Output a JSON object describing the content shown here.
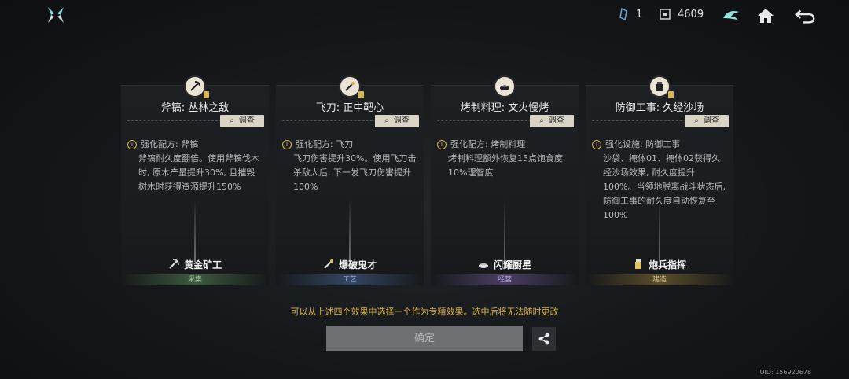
{
  "topbar": {
    "resources": [
      {
        "icon": "crystal-icon",
        "value": "1"
      },
      {
        "icon": "token-icon",
        "value": "4609"
      }
    ]
  },
  "cards": [
    {
      "title": "斧镐: 丛林之敌",
      "investigate": "调查",
      "desc_head": "强化配方: 斧镐",
      "desc_body": "斧镐耐久度翻倍。使用斧镐伐木时, 原木产量提升30%, 且摧毁树木时获得资源提升150%",
      "badge": "黄金矿工",
      "category": "采集",
      "category_color": "#3d5a3f"
    },
    {
      "title": "飞刀: 正中靶心",
      "investigate": "调查",
      "desc_head": "强化配方: 飞刀",
      "desc_body": "飞刀伤害提升30%。使用飞刀击杀敌人后, 下一发飞刀伤害提升100%",
      "badge": "爆破鬼才",
      "category": "工艺",
      "category_color": "#344663"
    },
    {
      "title": "烤制料理: 文火慢烤",
      "investigate": "调查",
      "desc_head": "强化配方: 烤制料理",
      "desc_body": "烤制料理额外恢复15点饱食度, 10%理智度",
      "badge": "闪耀厨星",
      "category": "经营",
      "category_color": "#4a3f63"
    },
    {
      "title": "防御工事: 久经沙场",
      "investigate": "调查",
      "desc_head": "强化设施: 防御工事",
      "desc_body": "沙袋、掩体01、掩体02获得久经沙场效果, 耐久度提升100%。当领地脱离战斗状态后, 防御工事的耐久度自动恢复至100%",
      "badge": "炮兵指挥",
      "category": "建造",
      "category_color": "#5a4e2a"
    }
  ],
  "notice": "可以从上述四个效果中选择一个作为专精效果。选中后将无法随时更改",
  "confirm_label": "确定",
  "uid": "UID: 156920678",
  "colors": {
    "accent": "#d9b24a",
    "confirm_bg": "#6e6f70"
  }
}
